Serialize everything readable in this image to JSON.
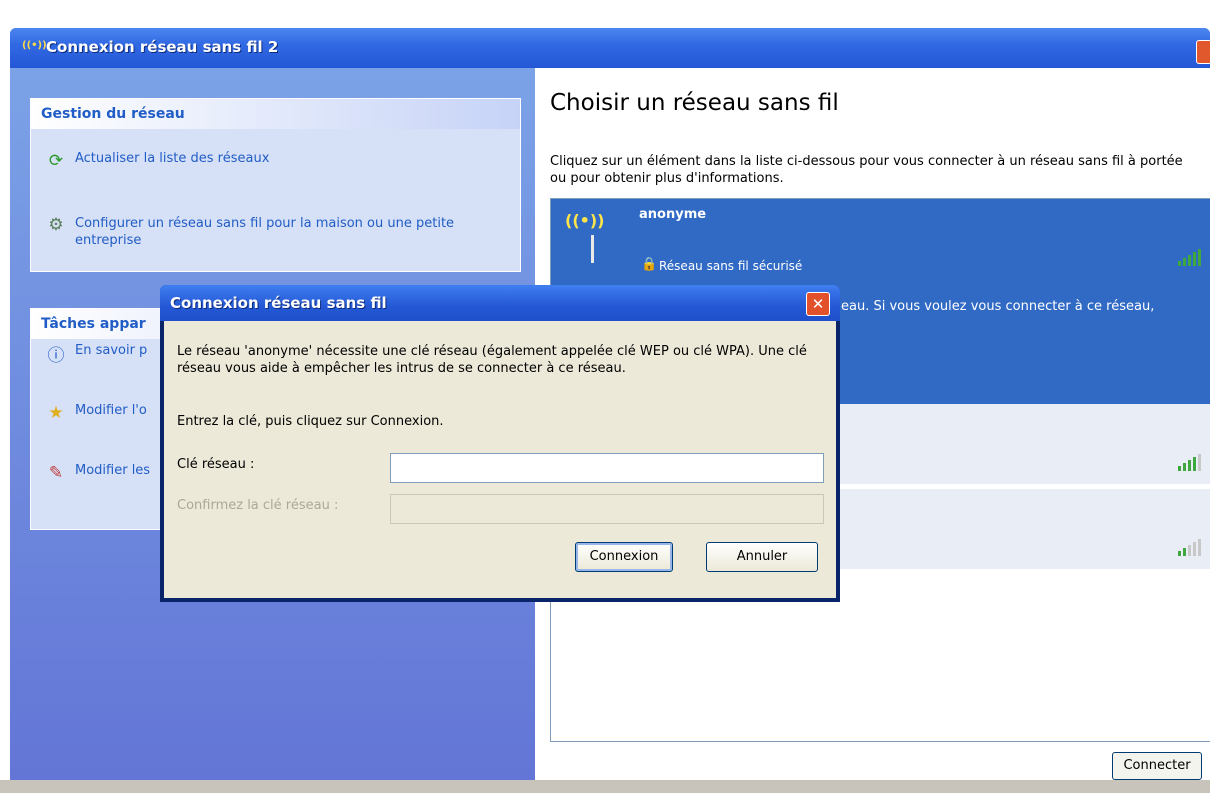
{
  "window": {
    "title": "Connexion réseau sans fil 2",
    "title_icon": "((•))"
  },
  "left_pane": {
    "gestion": {
      "header": "Gestion du réseau",
      "items": [
        {
          "label": "Actualiser la liste des réseaux",
          "icon": "refresh-icon"
        },
        {
          "label": "Configurer un réseau sans fil pour la maison ou une petite entreprise",
          "icon": "wizard-icon"
        }
      ]
    },
    "taches": {
      "header": "Tâches appar",
      "items": [
        {
          "label": "En savoir p",
          "icon": "info-icon"
        },
        {
          "label": "Modifier l'o",
          "icon": "star-icon"
        },
        {
          "label": "Modifier les",
          "icon": "settings-icon"
        }
      ]
    }
  },
  "right_pane": {
    "title": "Choisir un réseau sans fil",
    "description": "Cliquez sur un élément dans la liste ci-dessous pour vous connecter à un réseau sans fil à portée ou pour obtenir plus d'informations.",
    "networks": [
      {
        "name": "anonyme",
        "security": "Réseau sans fil sécurisé",
        "detail": "eau. Si vous voulez vous connecter à ce réseau,",
        "signal": 5
      },
      {
        "name": "",
        "signal": 4
      },
      {
        "name": "",
        "signal": 2
      }
    ],
    "connect_button": "Connecter"
  },
  "dialog": {
    "title": "Connexion réseau sans fil",
    "message": "Le réseau 'anonyme' nécessite une clé réseau (également appelée clé WEP ou clé WPA). Une clé réseau vous aide à empêcher les intrus de se connecter à ce réseau.",
    "instruction": "Entrez la clé, puis cliquez sur Connexion.",
    "key_label": "Clé réseau :",
    "key_value": "",
    "confirm_label": "Confirmez la clé réseau :",
    "confirm_value": "",
    "connect_button": "Connexion",
    "cancel_button": "Annuler",
    "close_glyph": "✕"
  },
  "colors": {
    "accent": "#316ac5",
    "link": "#215dc6",
    "signal": "#3ea83e"
  }
}
